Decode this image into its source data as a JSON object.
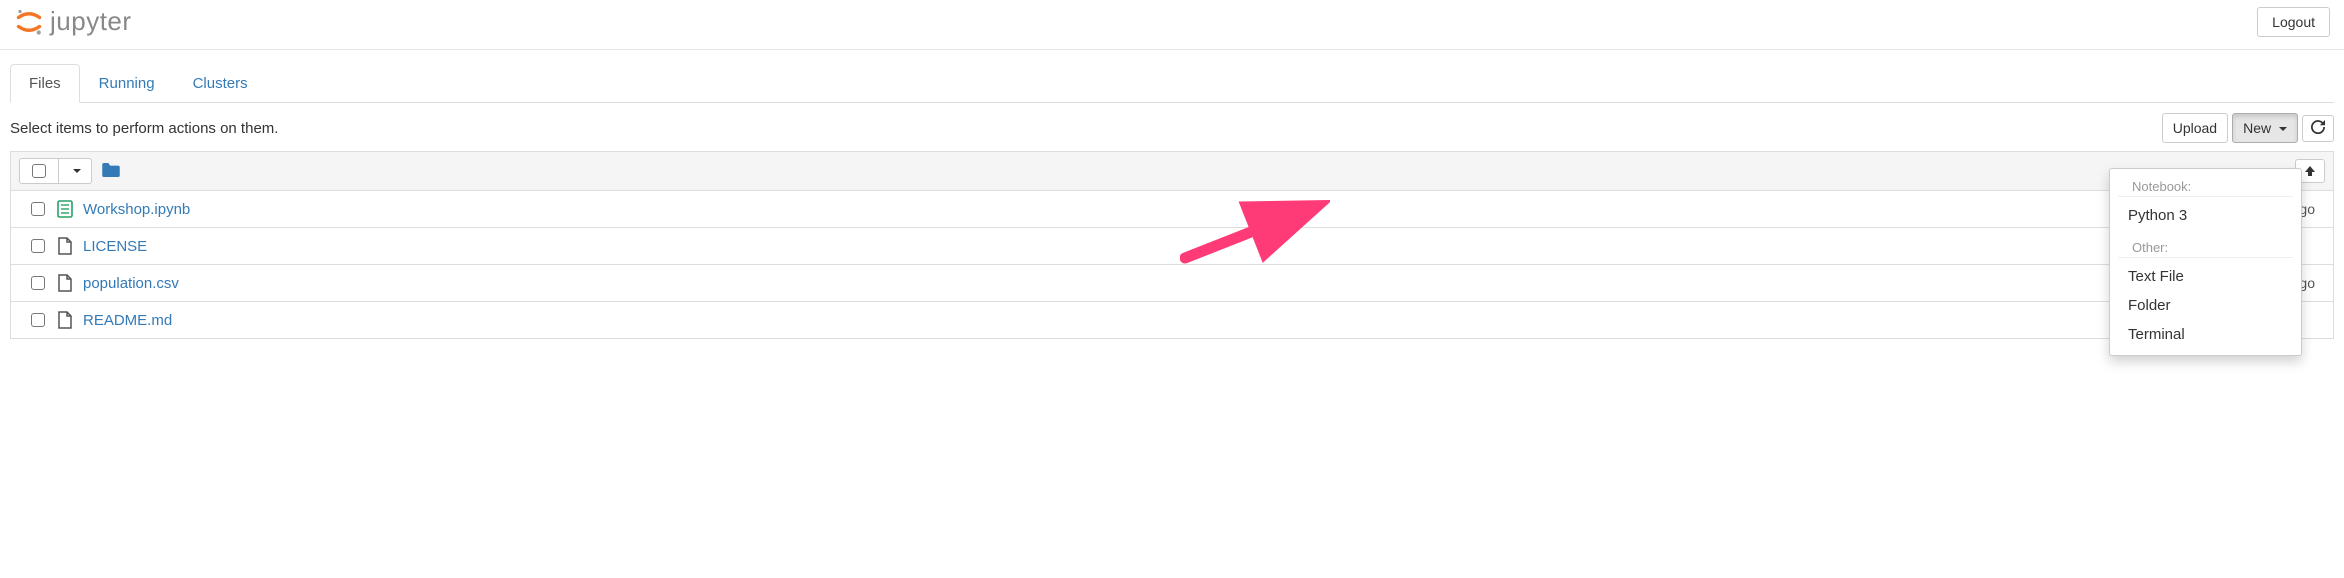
{
  "header": {
    "logo_text": "jupyter",
    "logout_label": "Logout"
  },
  "tabs": [
    {
      "label": "Files",
      "active": true
    },
    {
      "label": "Running",
      "active": false
    },
    {
      "label": "Clusters",
      "active": false
    }
  ],
  "hint": "Select items to perform actions on them.",
  "toolbar": {
    "upload_label": "Upload",
    "new_label": "New",
    "refresh_icon": "refresh"
  },
  "dropdown": {
    "section1_header": "Notebook:",
    "section1_items": [
      "Python 3"
    ],
    "section2_header": "Other:",
    "section2_items": [
      "Text File",
      "Folder",
      "Terminal"
    ]
  },
  "files": [
    {
      "icon": "notebook",
      "icon_color": "#26a269",
      "name": "Workshop.ipynb",
      "date": "go"
    },
    {
      "icon": "file",
      "icon_color": "#555",
      "name": "LICENSE",
      "date": ""
    },
    {
      "icon": "file",
      "icon_color": "#555",
      "name": "population.csv",
      "date": "go"
    },
    {
      "icon": "file",
      "icon_color": "#555",
      "name": "README.md",
      "date": ""
    }
  ],
  "colors": {
    "link": "#337ab7",
    "accent": "#f37626",
    "arrow": "#ff3b77"
  }
}
